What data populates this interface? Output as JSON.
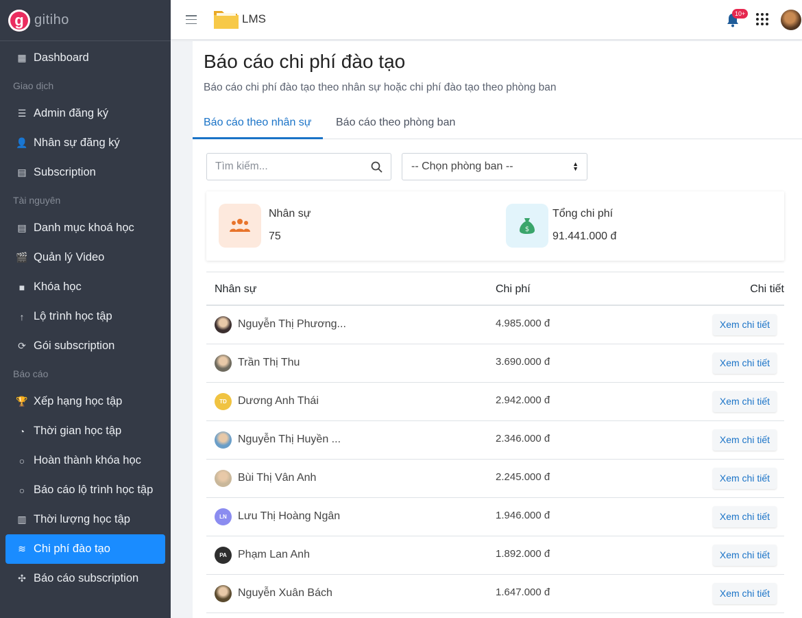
{
  "brand": {
    "logo_letter": "g",
    "name": "gitiho"
  },
  "sidebar": {
    "items": [
      {
        "type": "link",
        "label": "Dashboard",
        "icon": "dashboard-icon"
      },
      {
        "type": "section",
        "label": "Giao dịch"
      },
      {
        "type": "link",
        "label": "Admin đăng ký",
        "icon": "list-icon"
      },
      {
        "type": "link",
        "label": "Nhân sự đăng ký",
        "icon": "user-check-icon"
      },
      {
        "type": "link",
        "label": "Subscription",
        "icon": "subscription-icon"
      },
      {
        "type": "section",
        "label": "Tài nguyên"
      },
      {
        "type": "link",
        "label": "Danh mục khoá học",
        "icon": "catalog-icon"
      },
      {
        "type": "link",
        "label": "Quản lý Video",
        "icon": "clapper-icon"
      },
      {
        "type": "link",
        "label": "Khóa học",
        "icon": "video-camera-icon"
      },
      {
        "type": "link",
        "label": "Lộ trình học tập",
        "icon": "arrow-up-icon"
      },
      {
        "type": "link",
        "label": "Gói subscription",
        "icon": "refresh-icon"
      },
      {
        "type": "section",
        "label": "Báo cáo"
      },
      {
        "type": "link",
        "label": "Xếp hạng học tập",
        "icon": "trophy-icon"
      },
      {
        "type": "link",
        "label": "Thời gian học tập",
        "icon": "clock-icon"
      },
      {
        "type": "link",
        "label": "Hoàn thành khóa học",
        "icon": "circle-icon"
      },
      {
        "type": "link",
        "label": "Báo cáo lộ trình học tập",
        "icon": "circle-icon"
      },
      {
        "type": "link",
        "label": "Thời lượng học tập",
        "icon": "chart-icon"
      },
      {
        "type": "link",
        "label": "Chi phí đào tạo",
        "icon": "coins-icon",
        "active": true
      },
      {
        "type": "link",
        "label": "Báo cáo subscription",
        "icon": "network-icon"
      }
    ]
  },
  "topbar": {
    "app_name": "LMS",
    "notification_badge": "10+"
  },
  "page": {
    "title": "Báo cáo chi phí đào tạo",
    "subtitle": "Báo cáo chi phí đào tạo theo nhân sự hoặc chi phí đào tạo theo phòng ban",
    "tabs": [
      {
        "label": "Báo cáo theo nhân sự",
        "active": true
      },
      {
        "label": "Báo cáo theo phòng ban",
        "active": false
      }
    ],
    "search_placeholder": "Tìm kiếm...",
    "department_select": "-- Chọn phòng ban --"
  },
  "stats": {
    "staff_label": "Nhân sự",
    "staff_value": "75",
    "cost_label": "Tổng chi phí",
    "cost_value": "91.441.000 đ"
  },
  "table": {
    "headers": {
      "name": "Nhân sự",
      "cost": "Chi phí",
      "detail": "Chi tiết"
    },
    "rows": [
      {
        "name": "Nguyễn Thị Phương...",
        "cost": "4.985.000 đ",
        "action": "Xem chi tiết",
        "avatar": "photo",
        "avatar_color": "#3b2f2f"
      },
      {
        "name": "Trần Thị Thu",
        "cost": "3.690.000 đ",
        "action": "Xem chi tiết",
        "avatar": "photo",
        "avatar_color": "#6e6a5e"
      },
      {
        "name": "Dương Anh Thái",
        "cost": "2.942.000 đ",
        "action": "Xem chi tiết",
        "avatar": "TD",
        "avatar_color": "#f0c341"
      },
      {
        "name": "Nguyễn Thị Huyền ...",
        "cost": "2.346.000 đ",
        "action": "Xem chi tiết",
        "avatar": "photo",
        "avatar_color": "#6a9ec8"
      },
      {
        "name": "Bùi Thị Vân Anh",
        "cost": "2.245.000 đ",
        "action": "Xem chi tiết",
        "avatar": "photo",
        "avatar_color": "#c9b79a"
      },
      {
        "name": "Lưu Thị Hoàng Ngân",
        "cost": "1.946.000 đ",
        "action": "Xem chi tiết",
        "avatar": "LN",
        "avatar_color": "#8b8cf0"
      },
      {
        "name": "Phạm Lan Anh",
        "cost": "1.892.000 đ",
        "action": "Xem chi tiết",
        "avatar": "PA",
        "avatar_color": "#2e2e2e"
      },
      {
        "name": "Nguyễn Xuân Bách",
        "cost": "1.647.000 đ",
        "action": "Xem chi tiết",
        "avatar": "photo",
        "avatar_color": "#5a4a2e"
      }
    ]
  },
  "colors": {
    "sidebar_bg": "#343a46",
    "active_item": "#1a8cff",
    "link": "#1a73c7",
    "badge": "#e6274f"
  }
}
